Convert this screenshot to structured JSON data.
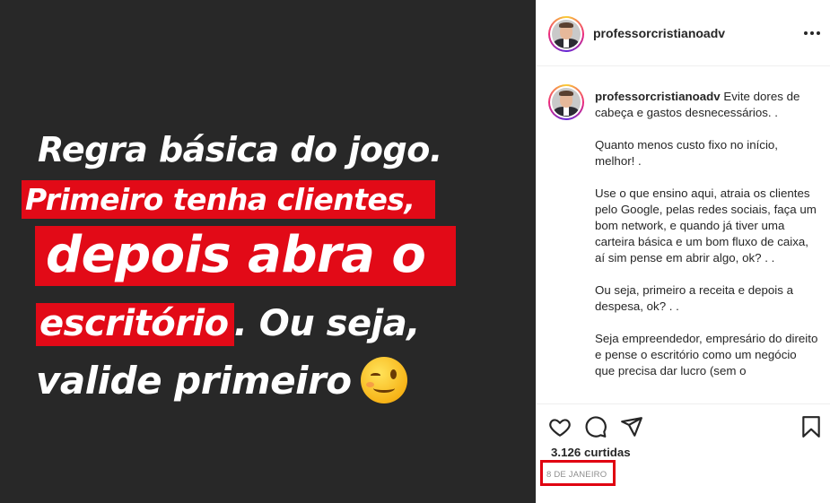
{
  "post": {
    "image_text": {
      "line1": "Regra básica do jogo.",
      "line2": "Primeiro tenha clientes,",
      "line3": "depois abra o",
      "line4_highlight": "escritório",
      "line4_rest": ". Ou seja,",
      "line5": "valide primeiro",
      "emoji": "winking-face"
    },
    "background_color": "#282828",
    "highlight_color": "#e20a17"
  },
  "header": {
    "username": "professorcristianoadv"
  },
  "caption": {
    "username": "professorcristianoadv",
    "paragraphs": [
      "Evite dores de cabeça e gastos desnecessários. .",
      "Quanto menos custo fixo no início, melhor! .",
      "Use o que ensino aqui, atraia os clientes pelo Google, pelas redes sociais, faça um bom network, e quando já tiver uma carteira básica e um bom fluxo de caixa, aí sim pense em abrir algo, ok? . .",
      "Ou seja, primeiro a receita e depois a despesa, ok? . .",
      "Seja empreendedor, empresário do direito e pense o escritório como um negócio que precisa dar lucro (sem o"
    ]
  },
  "actions": {
    "likes": "3.126 curtidas",
    "date": "8 DE JANEIRO",
    "icons": [
      "heart-icon",
      "comment-icon",
      "share-icon",
      "bookmark-icon"
    ],
    "annotation_color": "#e00010"
  }
}
